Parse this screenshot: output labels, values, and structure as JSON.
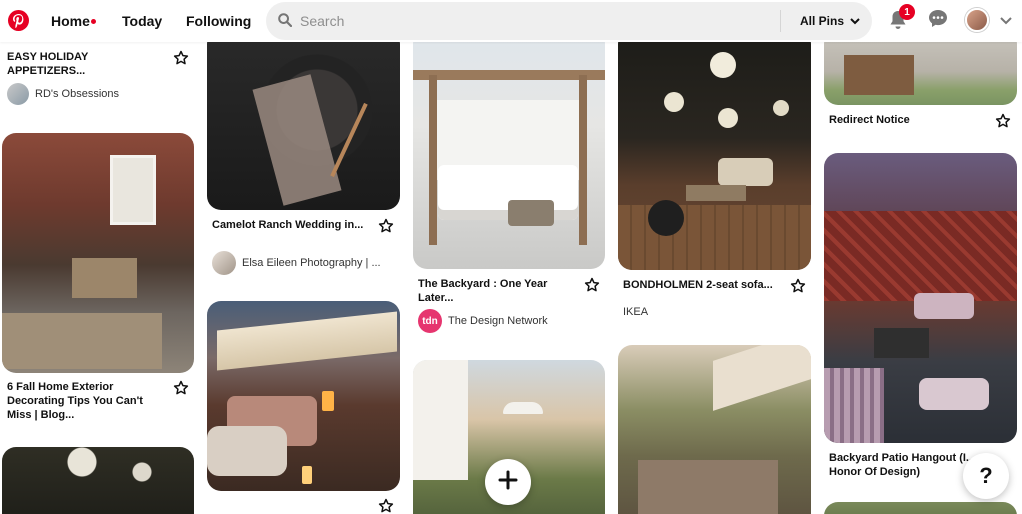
{
  "header": {
    "nav": {
      "home": "Home",
      "today": "Today",
      "following": "Following"
    },
    "search": {
      "placeholder": "Search",
      "value": ""
    },
    "scope_label": "All Pins",
    "notification_count": "1",
    "icons": [
      "pinterest-logo",
      "search-icon",
      "chevron-down-icon",
      "bell-icon",
      "chat-icon",
      "avatar",
      "chevron-down-icon"
    ]
  },
  "pins": {
    "c1a": {
      "title": "EASY HOLIDAY APPETIZERS...",
      "source": "RD's Obsessions"
    },
    "c1b": {
      "title": "6 Fall Home Exterior Decorating Tips You Can't Miss | Blog..."
    },
    "c2a": {
      "title": "Camelot Ranch Wedding in...",
      "source": "Elsa Eileen Photography | ..."
    },
    "c3a": {
      "title": "The Backyard : One Year Later...",
      "source": "The Design Network",
      "source_avatar_text": "tdn"
    },
    "c4a": {
      "title": "BONDHOLMEN 2-seat sofa...",
      "source": "IKEA"
    },
    "c5a": {
      "title": "Redirect Notice"
    },
    "c5b": {
      "title": "Backyard Patio Hangout (I... Honor Of Design)"
    }
  },
  "help_label": "?",
  "colors": {
    "brand": "#e60023",
    "search_bg": "#efefef"
  }
}
